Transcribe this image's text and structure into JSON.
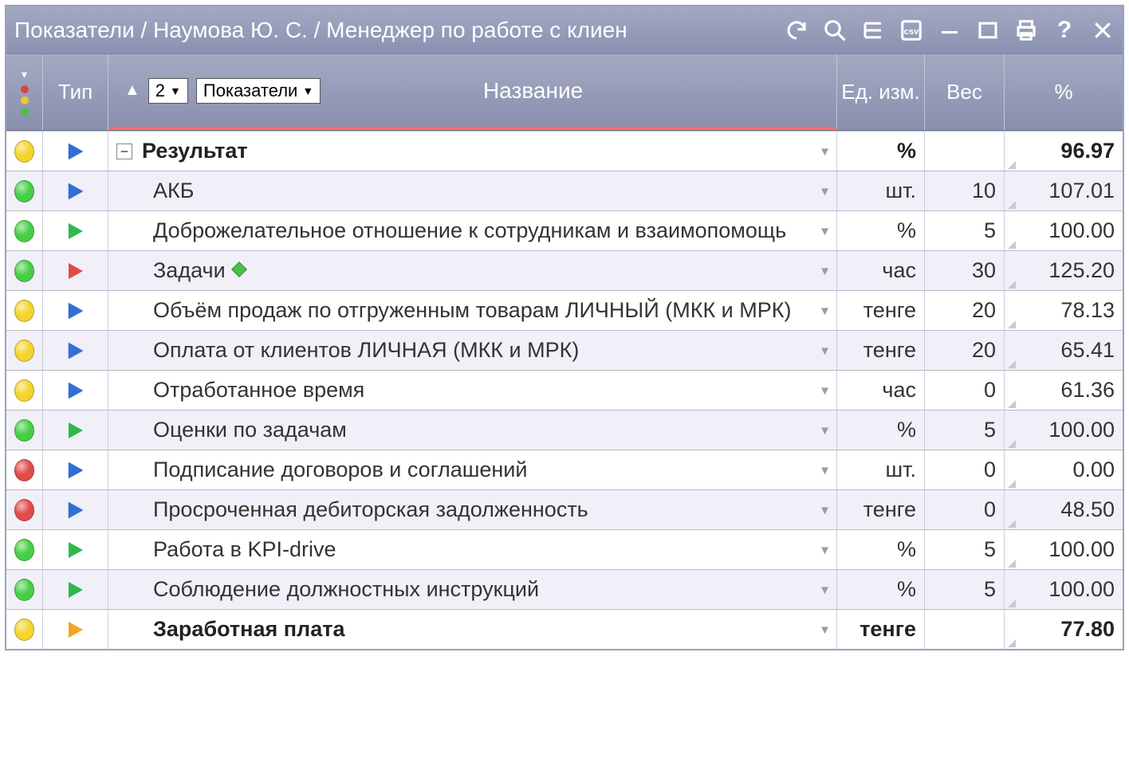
{
  "title": "Показатели / Наумова Ю. С. / Менеджер по работе с клиен",
  "header": {
    "type": "Тип",
    "level_value": "2",
    "filter_value": "Показатели",
    "name": "Название",
    "unit": "Ед. изм.",
    "weight": "Вес",
    "pct": "%"
  },
  "rows": [
    {
      "status": "yellow",
      "type_color": "blue",
      "indent": false,
      "bold": true,
      "expand": "minus",
      "name": "Результат",
      "diamond": false,
      "unit": "%",
      "weight": "",
      "pct": "96.97"
    },
    {
      "status": "green",
      "type_color": "blue",
      "indent": true,
      "bold": false,
      "expand": "",
      "name": "АКБ",
      "diamond": false,
      "unit": "шт.",
      "weight": "10",
      "pct": "107.01"
    },
    {
      "status": "green",
      "type_color": "green",
      "indent": true,
      "bold": false,
      "expand": "",
      "name": "Доброжелательное отношение к сотрудникам и взаимопомощь",
      "diamond": false,
      "unit": "%",
      "weight": "5",
      "pct": "100.00"
    },
    {
      "status": "green",
      "type_color": "red",
      "indent": true,
      "bold": false,
      "expand": "",
      "name": "Задачи",
      "diamond": true,
      "unit": "час",
      "weight": "30",
      "pct": "125.20"
    },
    {
      "status": "yellow",
      "type_color": "blue",
      "indent": true,
      "bold": false,
      "expand": "",
      "name": "Объём продаж по отгруженным товарам ЛИЧНЫЙ (МКК и МРК)",
      "diamond": false,
      "unit": "тенге",
      "weight": "20",
      "pct": "78.13"
    },
    {
      "status": "yellow",
      "type_color": "blue",
      "indent": true,
      "bold": false,
      "expand": "",
      "name": "Оплата от клиентов ЛИЧНАЯ (МКК и МРК)",
      "diamond": false,
      "unit": "тенге",
      "weight": "20",
      "pct": "65.41"
    },
    {
      "status": "yellow",
      "type_color": "blue",
      "indent": true,
      "bold": false,
      "expand": "",
      "name": "Отработанное время",
      "diamond": false,
      "unit": "час",
      "weight": "0",
      "pct": "61.36"
    },
    {
      "status": "green",
      "type_color": "green",
      "indent": true,
      "bold": false,
      "expand": "",
      "name": "Оценки по задачам",
      "diamond": false,
      "unit": "%",
      "weight": "5",
      "pct": "100.00"
    },
    {
      "status": "red",
      "type_color": "blue",
      "indent": true,
      "bold": false,
      "expand": "",
      "name": "Подписание договоров и соглашений",
      "diamond": false,
      "unit": "шт.",
      "weight": "0",
      "pct": "0.00"
    },
    {
      "status": "red",
      "type_color": "blue",
      "indent": true,
      "bold": false,
      "expand": "",
      "name": "Просроченная дебиторская задолженность",
      "diamond": false,
      "unit": "тенге",
      "weight": "0",
      "pct": "48.50"
    },
    {
      "status": "green",
      "type_color": "green",
      "indent": true,
      "bold": false,
      "expand": "",
      "name": "Работа в KPI-drive",
      "diamond": false,
      "unit": "%",
      "weight": "5",
      "pct": "100.00"
    },
    {
      "status": "green",
      "type_color": "green",
      "indent": true,
      "bold": false,
      "expand": "",
      "name": "Соблюдение должностных инструкций",
      "diamond": false,
      "unit": "%",
      "weight": "5",
      "pct": "100.00"
    },
    {
      "status": "yellow",
      "type_color": "orange",
      "indent": true,
      "bold": true,
      "expand": "",
      "name": "Заработная плата",
      "diamond": false,
      "unit": "тенге",
      "weight": "",
      "pct": "77.80"
    }
  ]
}
